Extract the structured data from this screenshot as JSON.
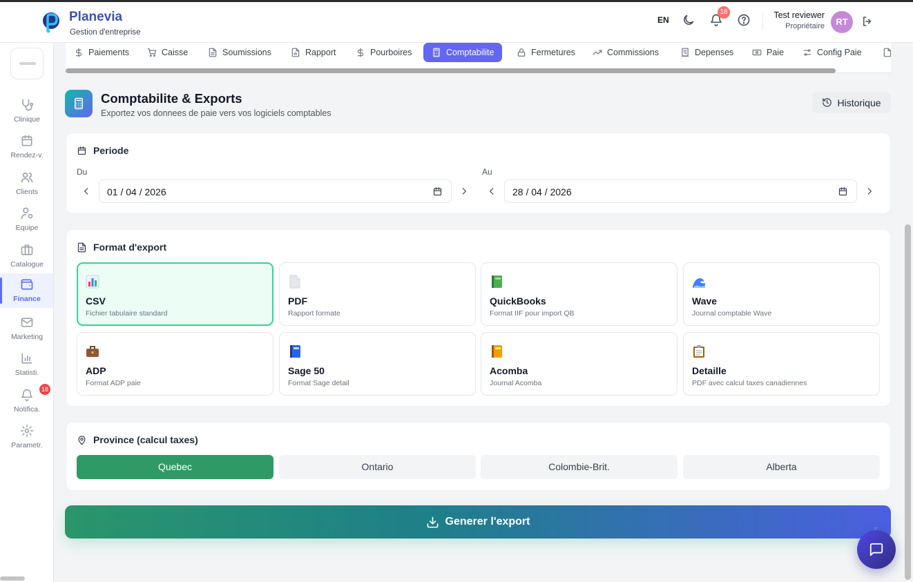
{
  "app": {
    "name": "Planevia",
    "subtitle": "Gestion d'entreprise"
  },
  "header": {
    "language": "EN",
    "notification_count": "18",
    "user_name": "Test reviewer",
    "user_role": "Propriétaire",
    "avatar_initials": "RT"
  },
  "sidebar": {
    "items": [
      {
        "label": "Clinique",
        "icon": "stethoscope-icon"
      },
      {
        "label": "Rendez-v.",
        "icon": "calendar-icon"
      },
      {
        "label": "Clients",
        "icon": "users-icon"
      },
      {
        "label": "Equipe",
        "icon": "user-gear-icon"
      },
      {
        "label": "Catalogue",
        "icon": "briefcase-icon"
      },
      {
        "label": "Finance",
        "icon": "wallet-icon"
      },
      {
        "label": "Marketing",
        "icon": "mail-icon"
      },
      {
        "label": "Statisti.",
        "icon": "bar-chart-icon"
      },
      {
        "label": "Notifica.",
        "icon": "bell-icon"
      },
      {
        "label": "Parametr.",
        "icon": "gear-icon"
      }
    ],
    "notification_badge": "18"
  },
  "tabs": [
    {
      "label": "Paiements",
      "icon": "dollar-icon"
    },
    {
      "label": "Caisse",
      "icon": "cart-icon"
    },
    {
      "label": "Soumissions",
      "icon": "document-icon"
    },
    {
      "label": "Rapport",
      "icon": "report-icon"
    },
    {
      "label": "Pourboires",
      "icon": "dollar-icon"
    },
    {
      "label": "Comptabilite",
      "icon": "calculator-icon"
    },
    {
      "label": "Fermetures",
      "icon": "lock-icon"
    },
    {
      "label": "Commissions",
      "icon": "trending-up-icon"
    },
    {
      "label": "Depenses",
      "icon": "receipt-icon"
    },
    {
      "label": "Paie",
      "icon": "banknote-icon"
    },
    {
      "label": "Config Paie",
      "icon": "sliders-icon"
    }
  ],
  "page": {
    "title": "Comptabilite & Exports",
    "subtitle": "Exportez vos donnees de paie vers vos logiciels comptables",
    "history_label": "Historique"
  },
  "period": {
    "title": "Periode",
    "from_label": "Du",
    "from_value": "01 / 04 / 2026",
    "to_label": "Au",
    "to_value": "28 / 04 / 2026"
  },
  "export_format": {
    "title": "Format d'export",
    "formats": [
      {
        "name": "CSV",
        "desc": "Fichier tabulaire standard",
        "icon": "bar-chart-emoji",
        "color": "#4f7bd9"
      },
      {
        "name": "PDF",
        "desc": "Rapport formate",
        "icon": "page-emoji",
        "color": "#d1d5db"
      },
      {
        "name": "QuickBooks",
        "desc": "Format IIF pour import QB",
        "icon": "green-book-emoji",
        "color": "#4caf50"
      },
      {
        "name": "Wave",
        "desc": "Journal comptable Wave",
        "icon": "wave-emoji",
        "color": "#3b82f6"
      },
      {
        "name": "ADP",
        "desc": "Format ADP paie",
        "icon": "briefcase-emoji",
        "color": "#8d5a34"
      },
      {
        "name": "Sage 50",
        "desc": "Format Sage detail",
        "icon": "blue-book-emoji",
        "color": "#2563eb"
      },
      {
        "name": "Acomba",
        "desc": "Journal Acomba",
        "icon": "orange-book-emoji",
        "color": "#f59e0b"
      },
      {
        "name": "Detaille",
        "desc": "PDF avec calcul taxes canadiennes",
        "icon": "clipboard-emoji",
        "color": "#a16207"
      }
    ],
    "selected": "CSV"
  },
  "province": {
    "title": "Province (calcul taxes)",
    "options": [
      "Quebec",
      "Ontario",
      "Colombie-Brit.",
      "Alberta"
    ],
    "selected": "Quebec"
  },
  "generate_label": "Generer l'export",
  "colors": {
    "accent": "#6366f1",
    "success": "#2f9a66",
    "selected_border": "#34d399",
    "badge": "#ef4444"
  }
}
